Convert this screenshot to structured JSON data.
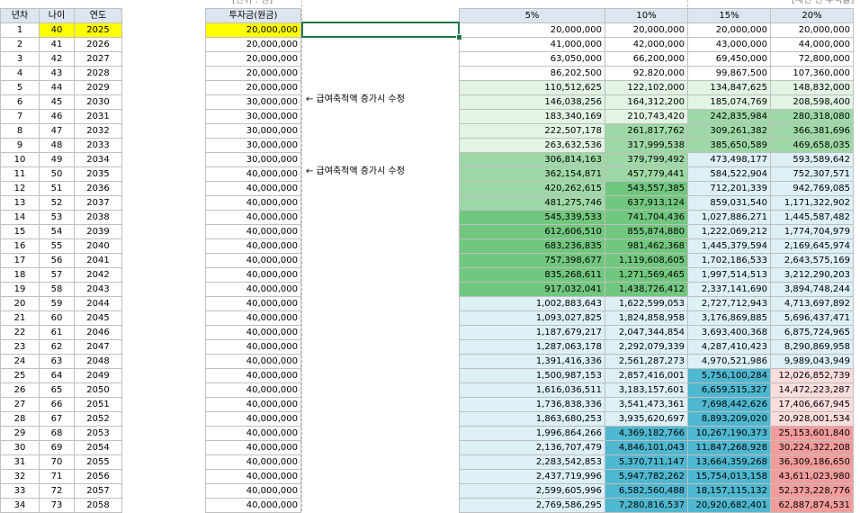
{
  "top_notes": {
    "unit": "[단위 : 원]",
    "right": "[세전 연 수익률]"
  },
  "left_table": {
    "headers": [
      "년차",
      "나이",
      "연도"
    ],
    "rows": [
      [
        "1",
        "40",
        "2025"
      ],
      [
        "2",
        "41",
        "2026"
      ],
      [
        "3",
        "42",
        "2027"
      ],
      [
        "4",
        "43",
        "2028"
      ],
      [
        "5",
        "44",
        "2029"
      ],
      [
        "6",
        "45",
        "2030"
      ],
      [
        "7",
        "46",
        "2031"
      ],
      [
        "8",
        "47",
        "2032"
      ],
      [
        "9",
        "48",
        "2033"
      ],
      [
        "10",
        "49",
        "2034"
      ],
      [
        "11",
        "50",
        "2035"
      ],
      [
        "12",
        "51",
        "2036"
      ],
      [
        "13",
        "52",
        "2037"
      ],
      [
        "14",
        "53",
        "2038"
      ],
      [
        "15",
        "54",
        "2039"
      ],
      [
        "16",
        "55",
        "2040"
      ],
      [
        "17",
        "56",
        "2041"
      ],
      [
        "18",
        "57",
        "2042"
      ],
      [
        "19",
        "58",
        "2043"
      ],
      [
        "20",
        "59",
        "2044"
      ],
      [
        "21",
        "60",
        "2045"
      ],
      [
        "22",
        "61",
        "2046"
      ],
      [
        "23",
        "62",
        "2047"
      ],
      [
        "24",
        "63",
        "2048"
      ],
      [
        "25",
        "64",
        "2049"
      ],
      [
        "26",
        "65",
        "2050"
      ],
      [
        "27",
        "66",
        "2051"
      ],
      [
        "28",
        "67",
        "2052"
      ],
      [
        "29",
        "68",
        "2053"
      ],
      [
        "30",
        "69",
        "2054"
      ],
      [
        "31",
        "70",
        "2055"
      ],
      [
        "32",
        "71",
        "2056"
      ],
      [
        "33",
        "72",
        "2057"
      ],
      [
        "34",
        "73",
        "2058"
      ]
    ]
  },
  "invest_table": {
    "header": "투자금(원금)",
    "values": [
      "20,000,000",
      "20,000,000",
      "20,000,000",
      "20,000,000",
      "20,000,000",
      "30,000,000",
      "30,000,000",
      "30,000,000",
      "30,000,000",
      "30,000,000",
      "40,000,000",
      "40,000,000",
      "40,000,000",
      "40,000,000",
      "40,000,000",
      "40,000,000",
      "40,000,000",
      "40,000,000",
      "40,000,000",
      "40,000,000",
      "40,000,000",
      "40,000,000",
      "40,000,000",
      "40,000,000",
      "40,000,000",
      "40,000,000",
      "40,000,000",
      "40,000,000",
      "40,000,000",
      "40,000,000",
      "40,000,000",
      "40,000,000",
      "40,000,000",
      "40,000,000"
    ]
  },
  "side_notes": [
    "← 급여축적액 증가시 수정",
    "← 급여축적액 증가시 수정"
  ],
  "rate_table": {
    "headers": [
      "5%",
      "10%",
      "15%",
      "20%"
    ],
    "rows": [
      [
        "20,000,000",
        "20,000,000",
        "20,000,000",
        "20,000,000"
      ],
      [
        "41,000,000",
        "42,000,000",
        "43,000,000",
        "44,000,000"
      ],
      [
        "63,050,000",
        "66,200,000",
        "69,450,000",
        "72,800,000"
      ],
      [
        "86,202,500",
        "92,820,000",
        "99,867,500",
        "107,360,000"
      ],
      [
        "110,512,625",
        "122,102,000",
        "134,847,625",
        "148,832,000"
      ],
      [
        "146,038,256",
        "164,312,200",
        "185,074,769",
        "208,598,400"
      ],
      [
        "183,340,169",
        "210,743,420",
        "242,835,984",
        "280,318,080"
      ],
      [
        "222,507,178",
        "261,817,762",
        "309,261,382",
        "366,381,696"
      ],
      [
        "263,632,536",
        "317,999,538",
        "385,650,589",
        "469,658,035"
      ],
      [
        "306,814,163",
        "379,799,492",
        "473,498,177",
        "593,589,642"
      ],
      [
        "362,154,871",
        "457,779,441",
        "584,522,904",
        "752,307,571"
      ],
      [
        "420,262,615",
        "543,557,385",
        "712,201,339",
        "942,769,085"
      ],
      [
        "481,275,746",
        "637,913,124",
        "859,031,540",
        "1,171,322,902"
      ],
      [
        "545,339,533",
        "741,704,436",
        "1,027,886,271",
        "1,445,587,482"
      ],
      [
        "612,606,510",
        "855,874,880",
        "1,222,069,212",
        "1,774,704,979"
      ],
      [
        "683,236,835",
        "981,462,368",
        "1,445,379,594",
        "2,169,645,974"
      ],
      [
        "757,398,677",
        "1,119,608,605",
        "1,702,186,533",
        "2,643,575,169"
      ],
      [
        "835,268,611",
        "1,271,569,465",
        "1,997,514,513",
        "3,212,290,203"
      ],
      [
        "917,032,041",
        "1,438,726,412",
        "2,337,141,690",
        "3,894,748,244"
      ],
      [
        "1,002,883,643",
        "1,622,599,053",
        "2,727,712,943",
        "4,713,697,892"
      ],
      [
        "1,093,027,825",
        "1,824,858,958",
        "3,176,869,885",
        "5,696,437,471"
      ],
      [
        "1,187,679,217",
        "2,047,344,854",
        "3,693,400,368",
        "6,875,724,965"
      ],
      [
        "1,287,063,178",
        "2,292,079,339",
        "4,287,410,423",
        "8,290,869,958"
      ],
      [
        "1,391,416,336",
        "2,561,287,273",
        "4,970,521,986",
        "9,989,043,949"
      ],
      [
        "1,500,987,153",
        "2,857,416,001",
        "5,756,100,284",
        "12,026,852,739"
      ],
      [
        "1,616,036,511",
        "3,183,157,601",
        "6,659,515,327",
        "14,472,223,287"
      ],
      [
        "1,736,838,336",
        "3,541,473,361",
        "7,698,442,626",
        "17,406,667,945"
      ],
      [
        "1,863,680,253",
        "3,935,620,697",
        "8,893,209,020",
        "20,928,001,534"
      ],
      [
        "1,996,864,266",
        "4,369,182,766",
        "10,267,190,373",
        "25,153,601,840"
      ],
      [
        "2,136,707,479",
        "4,846,101,043",
        "11,847,268,928",
        "30,224,322,208"
      ],
      [
        "2,283,542,853",
        "5,370,711,147",
        "13,664,359,268",
        "36,309,186,650"
      ],
      [
        "2,437,719,996",
        "5,947,782,262",
        "15,754,013,158",
        "43,611,023,980"
      ],
      [
        "2,599,605,996",
        "6,582,560,488",
        "18,157,115,132",
        "52,373,228,776"
      ],
      [
        "2,769,586,295",
        "7,280,816,537",
        "20,920,682,401",
        "62,887,874,531"
      ]
    ]
  },
  "colors": {
    "header_blue": "#dce6f1",
    "highlight_yellow": "#ffff00",
    "green_light": "#e2f4e3",
    "green_mid": "#9ed8a6",
    "green_dark": "#72c77f",
    "teal_light": "#dcf0f5",
    "teal_dark": "#4fb7d0",
    "red_light": "#fbdcdc",
    "red_dark": "#f29c9c",
    "selection": "#217346"
  }
}
